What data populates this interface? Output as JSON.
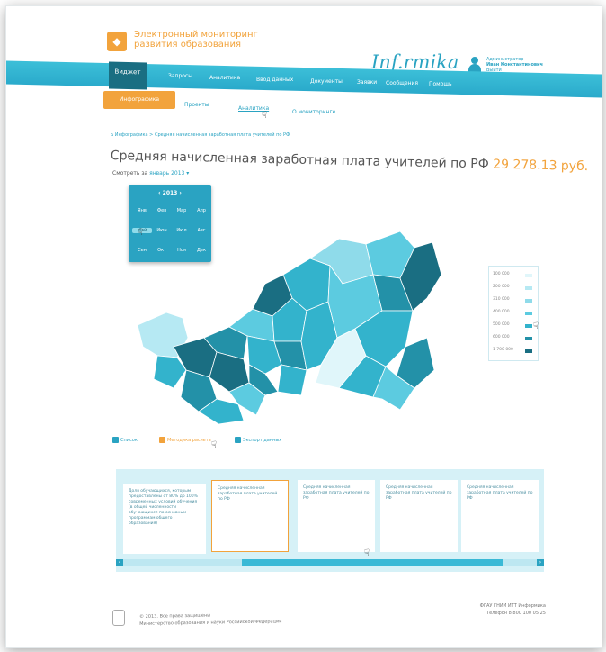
{
  "header": {
    "logo_title_line1": "Электронный мониторинг",
    "logo_title_line2": "развития образования",
    "brand": "Inf.rmika",
    "user_role": "Администратор",
    "user_name": "Иван Константинович",
    "user_logout": "Выйти"
  },
  "nav": {
    "active": "Виджет",
    "items": [
      "Запросы",
      "Аналитика",
      "Ввод данных",
      "Документы",
      "Заявки",
      "Сообщения",
      "Помощь"
    ]
  },
  "subnav": {
    "active": "Инфографика",
    "items": [
      "Проекты",
      "Аналитика",
      "О мониторинге"
    ]
  },
  "breadcrumb": "Инфографика  >  Средняя начисленная заработная плата учителей по РФ",
  "title": {
    "text": "Средняя начисленная заработная плата учителей по РФ",
    "value": "29 278.13 руб."
  },
  "period": {
    "label": "Смотреть за",
    "value": "январь 2013 ▾"
  },
  "calendar": {
    "year": "‹  2013  ›",
    "months": [
      "Янв",
      "Фев",
      "Мар",
      "Апр",
      "Май",
      "Июн",
      "Июл",
      "Авг",
      "Сен",
      "Окт",
      "Ноя",
      "Дек"
    ],
    "selected_index": 4
  },
  "legend": {
    "entries": [
      {
        "label": "100 000",
        "color": "#e0f6fa"
      },
      {
        "label": "200 000",
        "color": "#b6e9f3"
      },
      {
        "label": "310 000",
        "color": "#8fdbea"
      },
      {
        "label": "400 000",
        "color": "#5ccbe0"
      },
      {
        "label": "500 000",
        "color": "#33b3cc"
      },
      {
        "label": "600 000",
        "color": "#2391a8"
      },
      {
        "label": "1 700 000",
        "color": "#1a6e82"
      }
    ]
  },
  "tools": {
    "list": "Список",
    "method": "Методика расчета",
    "export": "Экспорт данных"
  },
  "cards": [
    "Доля обучающихся, которым предоставлены от 80% до 100% современных условий обучения (в общей численности обучающихся по основным программам общего образования)",
    "Средняя начисленная заработная плата учителей по РФ",
    "Средняя начисленная заработная плата учителей по РФ",
    "Средняя начисленная заработная плата учителей по РФ",
    "Средняя начисленная заработная плата учителей по РФ"
  ],
  "footer": {
    "copyright": "© 2013. Все права защищены",
    "ministry": "Министерство образования и науки Российской Федерации",
    "company": "ФГАУ ГНИИ ИТТ Информика",
    "phone": "Телефон 8 800 100 05 25"
  },
  "colors": {
    "accent": "#2aa3c2",
    "orange": "#f2a33c",
    "nav": "#3cbfd8",
    "dark": "#1a6e82"
  }
}
